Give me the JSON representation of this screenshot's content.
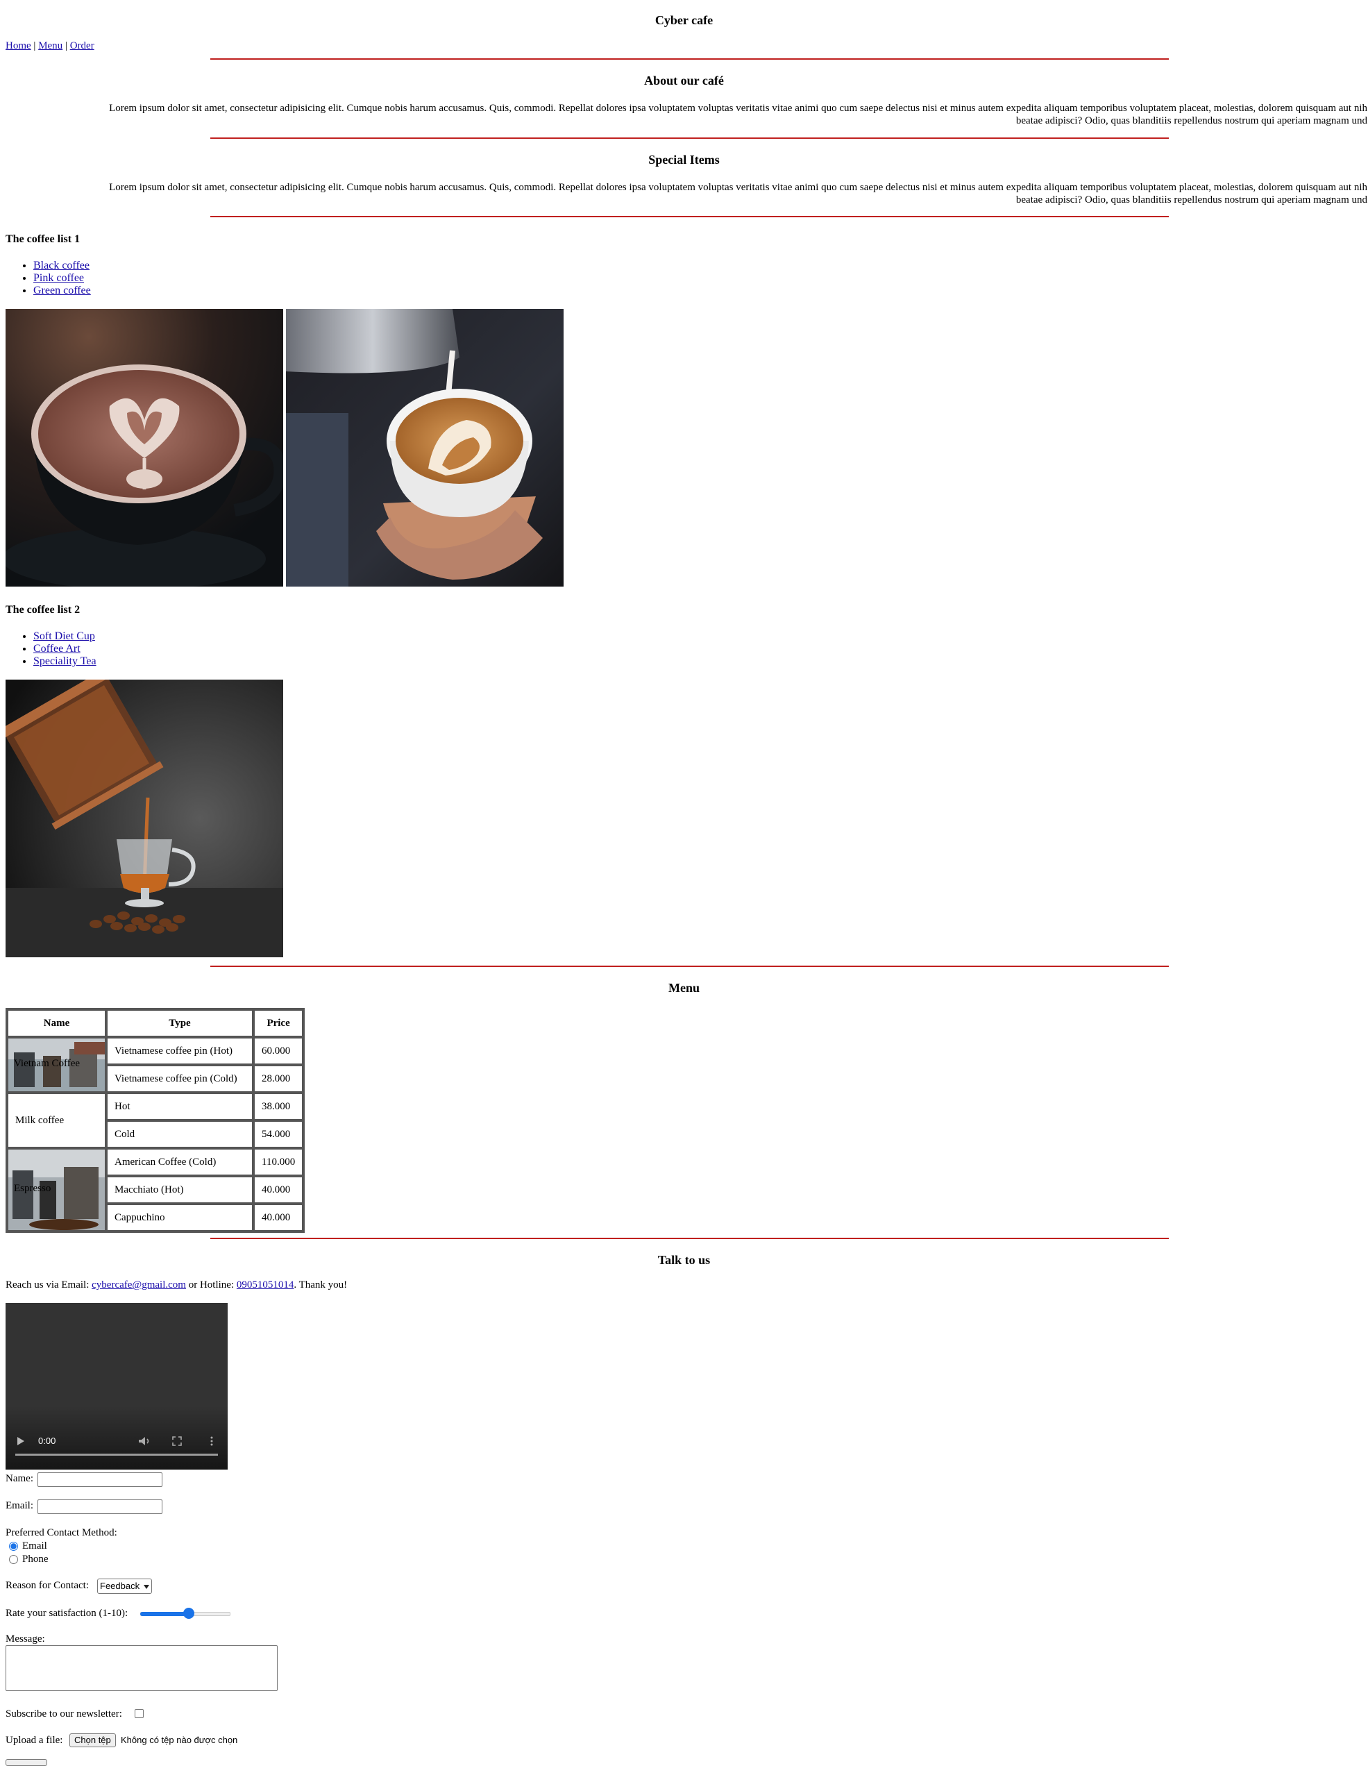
{
  "header": {
    "title": "Cyber cafe"
  },
  "nav": {
    "home": "Home",
    "menu": "Menu",
    "order": "Order",
    "sep": "|"
  },
  "about": {
    "title": "About our café",
    "line1": "Lorem ipsum dolor sit amet, consectetur adipisicing elit. Cumque nobis harum accusamus. Quis, commodi. Repellat dolores ipsa voluptatem voluptas veritatis vitae animi quo cum saepe delectus nisi et minus autem expedita aliquam temporibus voluptatem placeat, molestias, dolorem quisquam aut nih",
    "line2": "beatae adipisci? Odio, quas blanditiis repellendus nostrum qui aperiam magnam und"
  },
  "special": {
    "title": "Special Items",
    "line1": "Lorem ipsum dolor sit amet, consectetur adipisicing elit. Cumque nobis harum accusamus. Quis, commodi. Repellat dolores ipsa voluptatem voluptas veritatis vitae animi quo cum saepe delectus nisi et minus autem expedita aliquam temporibus voluptatem placeat, molestias, dolorem quisquam aut nih",
    "line2": "beatae adipisci? Odio, quas blanditiis repellendus nostrum qui aperiam magnam und"
  },
  "list1": {
    "title": "The coffee list 1",
    "items": [
      "Black coffee",
      "Pink coffee",
      "Green coffee"
    ]
  },
  "list2": {
    "title": "The coffee list 2",
    "items": [
      "Soft Diet Cup",
      "Coffee Art",
      "Speciality Tea"
    ]
  },
  "menu": {
    "title": "Menu",
    "headers": [
      "Name",
      "Type",
      "Price"
    ],
    "groups": [
      {
        "name": "Vietnam Coffee",
        "rows": [
          [
            "Vietnamese coffee pin (Hot)",
            "60.000"
          ],
          [
            "Vietnamese coffee pin (Cold)",
            "28.000"
          ]
        ]
      },
      {
        "name": "Milk coffee",
        "rows": [
          [
            "Hot",
            "38.000"
          ],
          [
            "Cold",
            "54.000"
          ]
        ]
      },
      {
        "name": "Espresso",
        "rows": [
          [
            "American Coffee (Cold)",
            "110.000"
          ],
          [
            "Macchiato (Hot)",
            "40.000"
          ],
          [
            "Cappuchino",
            "40.000"
          ]
        ]
      }
    ]
  },
  "contact": {
    "title": "Talk to us",
    "reach_prefix": "Reach us via Email:",
    "email": "cybercafe@gmail.com",
    "hotline_prefix": "or Hotline:",
    "hotline": "09051051014",
    "thanks": ". Thank you!"
  },
  "video": {
    "time": "0:00"
  },
  "form": {
    "name_label": "Name:",
    "email_label": "Email:",
    "method_label": "Preferred Contact Method:",
    "method_email": "Email",
    "method_phone": "Phone",
    "reason_label": "Reason for Contact:",
    "reason_value": "Feedback",
    "rating_label": "Rate your satisfaction (1-10):",
    "rating_value": 6,
    "rating_min": 1,
    "rating_max": 10,
    "message_label": "Message:",
    "newsletter_label": "Subscribe to our newsletter:",
    "upload_label": "Upload a file:",
    "choose_button": "Chọn tệp",
    "no_file": "Không có tệp nào được chọn"
  }
}
